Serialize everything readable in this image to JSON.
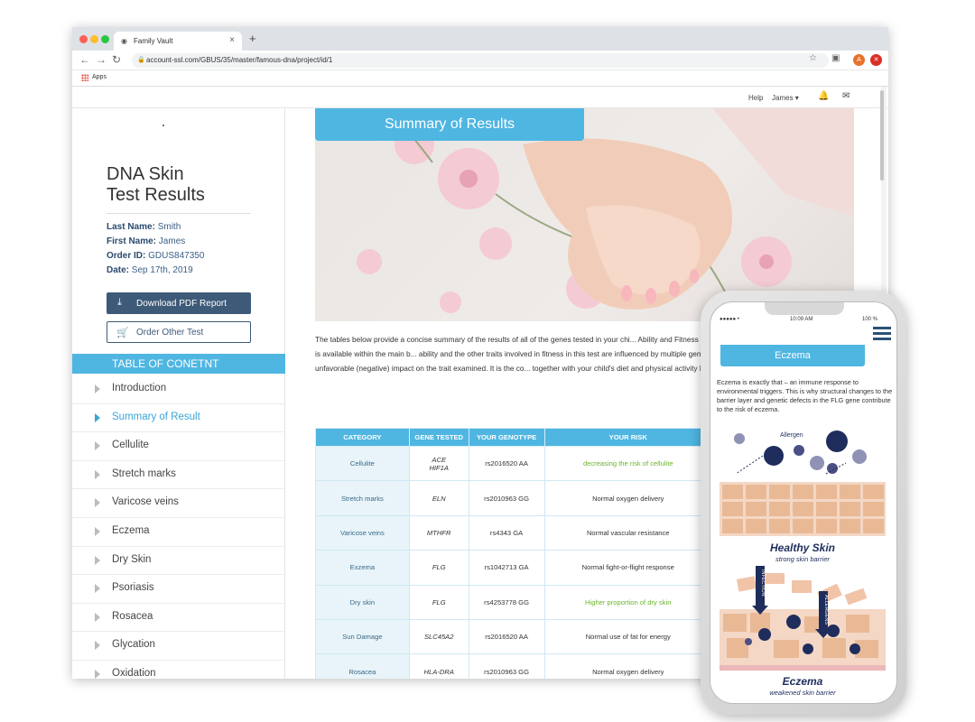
{
  "browser": {
    "tab_title": "Family Vault",
    "url": "account-ssl.com/GBUS/35/master/famous-dna/project/id/1",
    "bookmarks_apps": "Apps",
    "ext_a": "A",
    "ext_b": "✕"
  },
  "site_header": {
    "help": "Help",
    "user": "James ▾"
  },
  "sidebar": {
    "title_line1": "DNA Skin",
    "title_line2": "Test Results",
    "last_name_label": "Last Name:",
    "last_name": "Smith",
    "first_name_label": "First Name:",
    "first_name": "James",
    "order_id_label": "Order ID:",
    "order_id": "GDUS847350",
    "date_label": "Date:",
    "date": "Sep 17th, 2019",
    "download_label": "Download PDF Report",
    "order_label": "Order Other Test",
    "toc_heading": "TABLE OF CONETNT",
    "toc_items": [
      "Introduction",
      "Summary of Result",
      "Cellulite",
      "Stretch marks",
      "Varicose veins",
      "Eczema",
      "Dry Skin",
      "Psoriasis",
      "Rosacea",
      "Glycation",
      "Oxidation"
    ],
    "active_index": 1
  },
  "main": {
    "section_title": "Summary of Results",
    "intro": "The tables below provide a concise summary of the results of all of the genes tested in your chi... Ability and Fitness DNA Test. Additional information for each gene is available within the main b... ability and the other traits involved in fitness in this test are influenced by multiple genetic varia... beneficial (positive), neutral or unfavorable (negative) impact on the trait examined. It is the co... together with your child's diet and physical activity levels that influence their overall fitness.",
    "table": {
      "headers": [
        "CATEGORY",
        "GENE TESTED",
        "YOUR GENOTYPE",
        "YOUR RISK"
      ],
      "rows": [
        {
          "category": "Cellulite",
          "gene": "ACE\nHIF1A",
          "genotype": "rs2016520 AA",
          "risk": "decreasing the risk of cellulite",
          "highlight": true
        },
        {
          "category": "Stretch marks",
          "gene": "ELN",
          "genotype": "rs2010963 GG",
          "risk": "Normal oxygen delivery",
          "highlight": false
        },
        {
          "category": "Varicose veins",
          "gene": "MTHFR",
          "genotype": "rs4343 GA",
          "risk": "Normal vascular resistance",
          "highlight": false
        },
        {
          "category": "Exzema",
          "gene": "FLG",
          "genotype": "rs1042713 GA",
          "risk": "Normal fight-or-flight response",
          "highlight": false
        },
        {
          "category": "Dry skin",
          "gene": "FLG",
          "genotype": "rs4253778 GG",
          "risk": "Higher proportion of dry skin",
          "highlight": true
        },
        {
          "category": "Sun Damage",
          "gene": "SLC45A2",
          "genotype": "rs2016520 AA",
          "risk": "Normal use of fat for energy",
          "highlight": false
        },
        {
          "category": "Rosacea",
          "gene": "HLA-DRA",
          "genotype": "rs2010963 GG",
          "risk": "Normal oxygen delivery",
          "highlight": false
        }
      ]
    }
  },
  "phone": {
    "carrier": "●●●●● •",
    "time": "10:09 AM",
    "battery": "100 %",
    "section_title": "Eczema",
    "text": "Eczema is exactly that – an immune response to environmental triggers. This is why structural changes to the barrier layer and genetic defects in the FLG gene contribute to the risk of eczema.",
    "allergen_label": "Allergen",
    "healthy_title": "Healthy Skin",
    "healthy_sub": "strong skin barrier",
    "infection_label": "INFECTION",
    "allergens_label": "ALLERGENS",
    "eczema_title": "Eczema",
    "eczema_sub": "weakened skin barrier"
  },
  "colors": {
    "accent": "#4fb6e1",
    "navy": "#3d5a78",
    "green": "#6ab42d",
    "diagram_navy": "#1f2d5c"
  }
}
